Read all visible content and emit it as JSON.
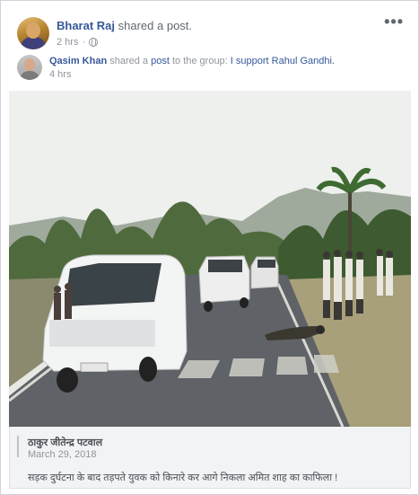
{
  "post": {
    "poster_name": "Bharat Raj",
    "shared_text": " shared a post.",
    "time": "2 hrs",
    "separator": "·",
    "privacy_icon": "globe-icon",
    "more_icon": "more-options-icon",
    "more_label": "•••"
  },
  "shared": {
    "author_name": "Qasim Khan",
    "shared_text": " shared a ",
    "post_link": "post",
    "to_group_text": " to the group: ",
    "group_name": "I support Rahul Gandhi.",
    "time": "4 hrs"
  },
  "preview": {
    "author": "ठाकुर जीतेन्द्र पटवाल",
    "date": "March 29, 2018",
    "caption": "सड़क दुर्घटना के बाद तड़पते युवक को किनारे कर आगे निकला अमित शाह का काफिला !"
  },
  "colors": {
    "link_blue": "#365899",
    "meta_gray": "#90949c",
    "preview_bg": "#f2f3f5"
  }
}
